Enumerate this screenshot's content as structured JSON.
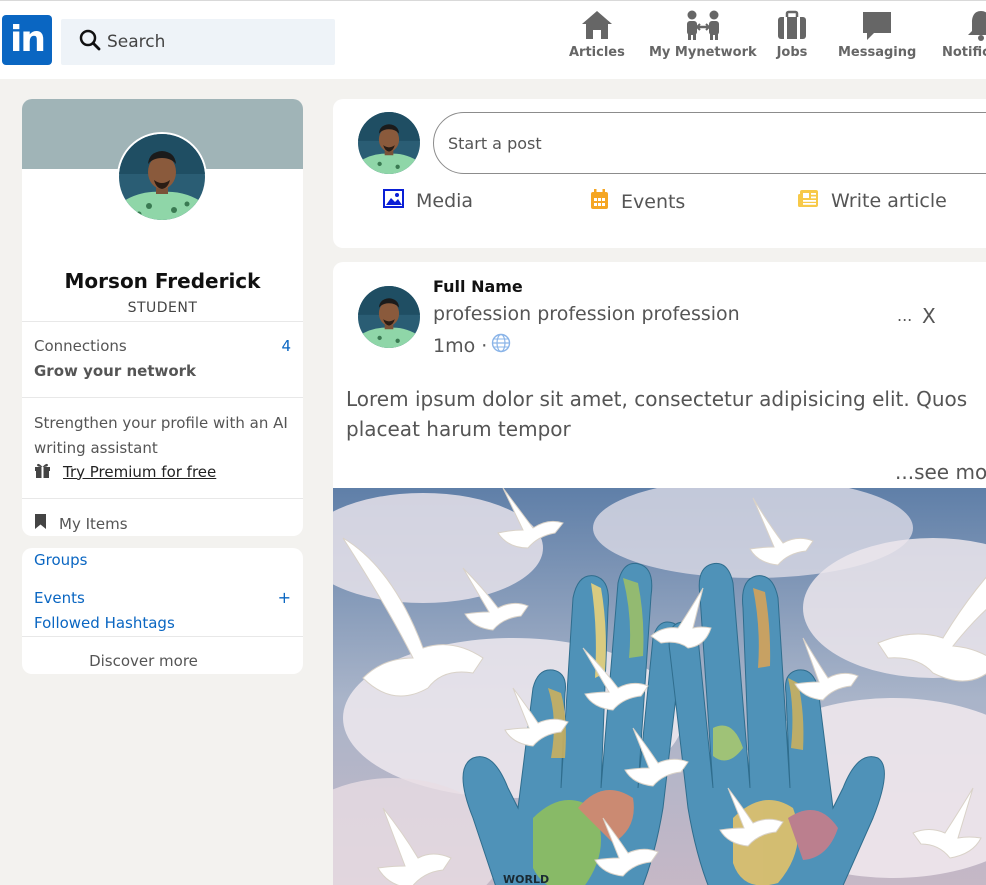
{
  "header": {
    "logo_text": "in",
    "search_placeholder": "Search",
    "nav": [
      {
        "label": "Articles",
        "icon": "home-icon"
      },
      {
        "label": "My Mynetwork",
        "icon": "network-icon"
      },
      {
        "label": "Jobs",
        "icon": "briefcase-icon"
      },
      {
        "label": "Messaging",
        "icon": "message-icon"
      },
      {
        "label": "Notific",
        "icon": "bell-icon"
      }
    ]
  },
  "profile": {
    "name": "Morson Frederick",
    "role": "STUDENT",
    "connections_label": "Connections",
    "connections_count": "4",
    "grow_label": "Grow your network",
    "strengthen_text": "Strengthen your profile with an AI writing assistant",
    "premium_label": "Try Premium for free",
    "my_items_label": "My Items"
  },
  "groups": {
    "groups_label": "Groups",
    "events_label": "Events",
    "events_add": "+",
    "hashtags_label": "Followed Hashtags",
    "discover_label": "Discover more"
  },
  "start_post": {
    "placeholder": "Start a post",
    "media_label": "Media",
    "events_label": "Events",
    "article_label": "Write article"
  },
  "post": {
    "full_name": "Full Name",
    "profession": "profession profession profession",
    "time": "1mo ·",
    "menu": "...",
    "close": "X",
    "body": "Lorem ipsum dolor sit amet, consectetur adipisicing elit. Quos placeat harum tempor",
    "see_more": "...see mo",
    "image_caption": "WORLD"
  },
  "colors": {
    "brand": "#0a66c2",
    "background": "#f3f2ef",
    "cover": "#a0b4b7",
    "events_icon": "#f5a623",
    "article_icon": "#f7c948"
  }
}
